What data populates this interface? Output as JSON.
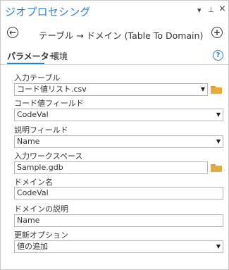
{
  "titlebar": {
    "title": "ジオプロセシング",
    "menu_icon": "▾",
    "pin_icon": "⊥",
    "close_icon": "×"
  },
  "nav": {
    "back_icon": "←",
    "title": "テーブル → ドメイン (Table To Domain)",
    "add_icon": "+"
  },
  "tabs": {
    "parameters": "パラメーター",
    "environments": "環境",
    "help_icon": "?"
  },
  "form": {
    "input_table": {
      "label": "入力テーブル",
      "value": "コード値リスト.csv"
    },
    "code_field": {
      "label": "コード値フィールド",
      "value": "CodeVal"
    },
    "description_field": {
      "label": "説明フィールド",
      "value": "Name"
    },
    "input_workspace": {
      "label": "入力ワークスペース",
      "value": "Sample.gdb"
    },
    "domain_name": {
      "label": "ドメイン名",
      "value": "CodeVal"
    },
    "domain_description": {
      "label": "ドメインの説明",
      "value": "Name"
    },
    "update_option": {
      "label": "更新オプション",
      "value": "値の追加"
    }
  },
  "colors": {
    "accent": "#2a7fd4",
    "folder": "#e8ab3a",
    "border": "#b5b5b5"
  }
}
